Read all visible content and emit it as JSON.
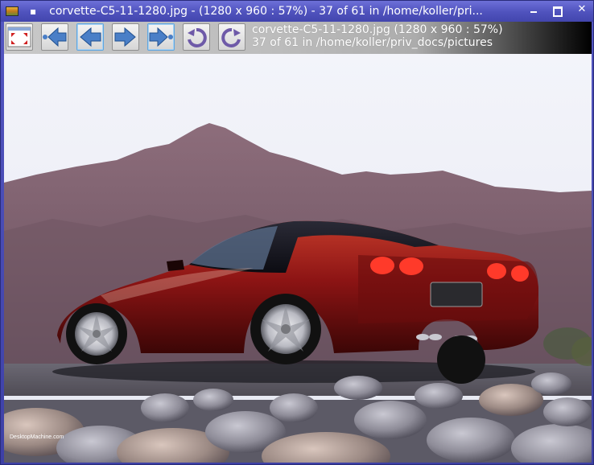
{
  "window": {
    "title": "corvette-C5-11-1280.jpg  - (1280 x 960 : 57%) - 37 of 61 in /home/koller/pri..."
  },
  "toolbar": {
    "buttons": [
      {
        "name": "fit-window-button",
        "icon": "fit-window-icon"
      },
      {
        "name": "first-image-button",
        "icon": "first-arrow-icon"
      },
      {
        "name": "previous-image-button",
        "icon": "previous-arrow-icon"
      },
      {
        "name": "next-image-button",
        "icon": "next-arrow-icon"
      },
      {
        "name": "last-image-button",
        "icon": "last-arrow-icon"
      },
      {
        "name": "rotate-left-button",
        "icon": "rotate-left-icon"
      },
      {
        "name": "rotate-right-button",
        "icon": "rotate-right-icon"
      }
    ],
    "info_line1": "corvette-C5-11-1280.jpg (1280 x 960 : 57%)",
    "info_line2": "37 of 61 in /home/koller/priv_docs/pictures"
  },
  "image": {
    "watermark": "DesktopMachine.com"
  },
  "colors": {
    "title_bar": "#5457c2",
    "toolbar_bg": "#c8c8c8",
    "arrow_blue": "#4a7fc7",
    "car_red": "#8c1414"
  }
}
